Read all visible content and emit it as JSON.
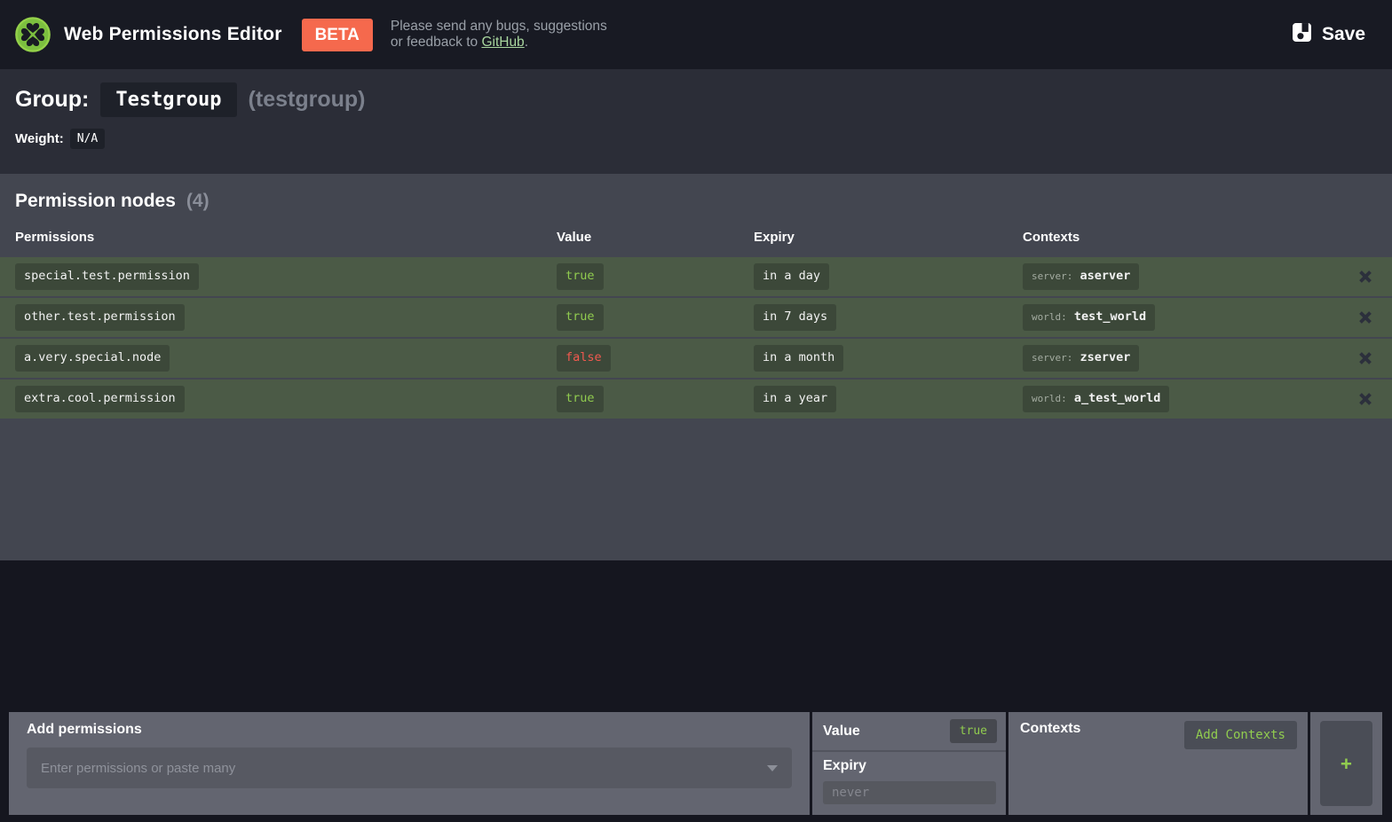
{
  "header": {
    "app_title": "Web Permissions Editor",
    "beta_badge": "BETA",
    "feedback_line1": "Please send any bugs, suggestions",
    "feedback_line2": "or feedback to ",
    "feedback_link": "GitHub",
    "feedback_suffix": ".",
    "save_label": "Save"
  },
  "group": {
    "label": "Group:",
    "name": "Testgroup",
    "id": "(testgroup)",
    "weight_label": "Weight:",
    "weight_value": "N/A"
  },
  "nodes": {
    "title": "Permission nodes",
    "count": "(4)",
    "columns": [
      "Permissions",
      "Value",
      "Expiry",
      "Contexts"
    ],
    "rows": [
      {
        "permission": "special.test.permission",
        "value": "true",
        "expiry": "in a day",
        "context_key": "server:",
        "context_value": "aserver"
      },
      {
        "permission": "other.test.permission",
        "value": "true",
        "expiry": "in 7 days",
        "context_key": "world:",
        "context_value": "test_world"
      },
      {
        "permission": "a.very.special.node",
        "value": "false",
        "expiry": "in a month",
        "context_key": "server:",
        "context_value": "zserver"
      },
      {
        "permission": "extra.cool.permission",
        "value": "true",
        "expiry": "in a year",
        "context_key": "world:",
        "context_value": "a_test_world"
      }
    ]
  },
  "add_bar": {
    "title": "Add permissions",
    "input_placeholder": "Enter permissions or paste many",
    "value_label": "Value",
    "value_current": "true",
    "expiry_label": "Expiry",
    "expiry_placeholder": "never",
    "contexts_label": "Contexts",
    "add_contexts_label": "Add Contexts",
    "add_button_label": "+"
  },
  "icons": {
    "logo": "clover-icon",
    "save": "floppy-disk-icon",
    "permissions_dropdown": "caret-down-icon",
    "row_delete": "x-icon",
    "add_node": "plus-icon"
  },
  "colors": {
    "accent_green": "#91cc4f",
    "false_red": "#f2594f",
    "beta_badge": "#f5694d",
    "link_green": "#a8d69e",
    "row_green": "#4b5a46",
    "chip_dark_green": "#3c4839",
    "header_bg": "#181a23",
    "section_gray": "#434650",
    "panel_gray": "#636570"
  }
}
